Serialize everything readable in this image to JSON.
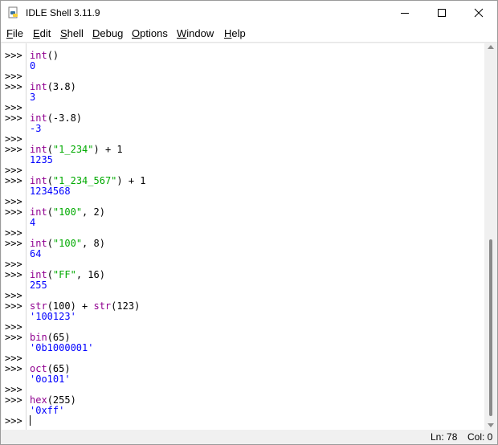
{
  "window": {
    "title": "IDLE Shell 3.11.9",
    "controls": [
      "minimize",
      "maximize",
      "close"
    ]
  },
  "menu": [
    {
      "label": "File",
      "mnemonic": "F",
      "rest": "ile"
    },
    {
      "label": "Edit",
      "mnemonic": "E",
      "rest": "dit"
    },
    {
      "label": "Shell",
      "mnemonic": "S",
      "rest": "hell"
    },
    {
      "label": "Debug",
      "mnemonic": "D",
      "rest": "ebug"
    },
    {
      "label": "Options",
      "mnemonic": "O",
      "rest": "ptions"
    },
    {
      "label": "Window",
      "mnemonic": "W",
      "rest": "indow"
    },
    {
      "label": "Help",
      "mnemonic": "H",
      "rest": "elp"
    }
  ],
  "shell": {
    "prompt": ">>>",
    "colors": {
      "builtin": "#900090",
      "string": "#00aa00",
      "output": "#0000ff",
      "normal": "#000000"
    },
    "lines": [
      {
        "prompt": true,
        "segments": [
          {
            "t": "int",
            "c": "builtin"
          },
          {
            "t": "()",
            "c": "normal"
          }
        ]
      },
      {
        "prompt": false,
        "segments": [
          {
            "t": "0",
            "c": "out"
          }
        ]
      },
      {
        "prompt": true,
        "segments": []
      },
      {
        "prompt": true,
        "segments": [
          {
            "t": "int",
            "c": "builtin"
          },
          {
            "t": "(3.8)",
            "c": "normal"
          }
        ]
      },
      {
        "prompt": false,
        "segments": [
          {
            "t": "3",
            "c": "out"
          }
        ]
      },
      {
        "prompt": true,
        "segments": []
      },
      {
        "prompt": true,
        "segments": [
          {
            "t": "int",
            "c": "builtin"
          },
          {
            "t": "(-3.8)",
            "c": "normal"
          }
        ]
      },
      {
        "prompt": false,
        "segments": [
          {
            "t": "-3",
            "c": "out"
          }
        ]
      },
      {
        "prompt": true,
        "segments": []
      },
      {
        "prompt": true,
        "segments": [
          {
            "t": "int",
            "c": "builtin"
          },
          {
            "t": "(",
            "c": "normal"
          },
          {
            "t": "\"1_234\"",
            "c": "str"
          },
          {
            "t": ") + 1",
            "c": "normal"
          }
        ]
      },
      {
        "prompt": false,
        "segments": [
          {
            "t": "1235",
            "c": "out"
          }
        ]
      },
      {
        "prompt": true,
        "segments": []
      },
      {
        "prompt": true,
        "segments": [
          {
            "t": "int",
            "c": "builtin"
          },
          {
            "t": "(",
            "c": "normal"
          },
          {
            "t": "\"1_234_567\"",
            "c": "str"
          },
          {
            "t": ") + 1",
            "c": "normal"
          }
        ]
      },
      {
        "prompt": false,
        "segments": [
          {
            "t": "1234568",
            "c": "out"
          }
        ]
      },
      {
        "prompt": true,
        "segments": []
      },
      {
        "prompt": true,
        "segments": [
          {
            "t": "int",
            "c": "builtin"
          },
          {
            "t": "(",
            "c": "normal"
          },
          {
            "t": "\"100\"",
            "c": "str"
          },
          {
            "t": ", 2)",
            "c": "normal"
          }
        ]
      },
      {
        "prompt": false,
        "segments": [
          {
            "t": "4",
            "c": "out"
          }
        ]
      },
      {
        "prompt": true,
        "segments": []
      },
      {
        "prompt": true,
        "segments": [
          {
            "t": "int",
            "c": "builtin"
          },
          {
            "t": "(",
            "c": "normal"
          },
          {
            "t": "\"100\"",
            "c": "str"
          },
          {
            "t": ", 8)",
            "c": "normal"
          }
        ]
      },
      {
        "prompt": false,
        "segments": [
          {
            "t": "64",
            "c": "out"
          }
        ]
      },
      {
        "prompt": true,
        "segments": []
      },
      {
        "prompt": true,
        "segments": [
          {
            "t": "int",
            "c": "builtin"
          },
          {
            "t": "(",
            "c": "normal"
          },
          {
            "t": "\"FF\"",
            "c": "str"
          },
          {
            "t": ", 16)",
            "c": "normal"
          }
        ]
      },
      {
        "prompt": false,
        "segments": [
          {
            "t": "255",
            "c": "out"
          }
        ]
      },
      {
        "prompt": true,
        "segments": []
      },
      {
        "prompt": true,
        "segments": [
          {
            "t": "str",
            "c": "builtin"
          },
          {
            "t": "(100) + ",
            "c": "normal"
          },
          {
            "t": "str",
            "c": "builtin"
          },
          {
            "t": "(123)",
            "c": "normal"
          }
        ]
      },
      {
        "prompt": false,
        "segments": [
          {
            "t": "'100123'",
            "c": "out"
          }
        ]
      },
      {
        "prompt": true,
        "segments": []
      },
      {
        "prompt": true,
        "segments": [
          {
            "t": "bin",
            "c": "builtin"
          },
          {
            "t": "(65)",
            "c": "normal"
          }
        ]
      },
      {
        "prompt": false,
        "segments": [
          {
            "t": "'0b1000001'",
            "c": "out"
          }
        ]
      },
      {
        "prompt": true,
        "segments": []
      },
      {
        "prompt": true,
        "segments": [
          {
            "t": "oct",
            "c": "builtin"
          },
          {
            "t": "(65)",
            "c": "normal"
          }
        ]
      },
      {
        "prompt": false,
        "segments": [
          {
            "t": "'0o101'",
            "c": "out"
          }
        ]
      },
      {
        "prompt": true,
        "segments": []
      },
      {
        "prompt": true,
        "segments": [
          {
            "t": "hex",
            "c": "builtin"
          },
          {
            "t": "(255)",
            "c": "normal"
          }
        ]
      },
      {
        "prompt": false,
        "segments": [
          {
            "t": "'0xff'",
            "c": "out"
          }
        ]
      },
      {
        "prompt": true,
        "segments": []
      }
    ]
  },
  "status": {
    "line": "Ln: 78",
    "col": "Col: 0"
  }
}
